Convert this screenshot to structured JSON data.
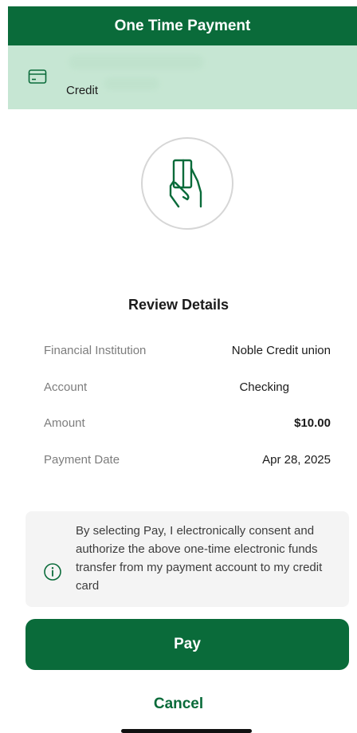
{
  "header": {
    "title": "One Time Payment"
  },
  "account_banner": {
    "icon": "credit-card-icon",
    "label": "Credit"
  },
  "illustration": {
    "icon": "hand-holding-card-icon"
  },
  "review": {
    "title": "Review Details",
    "rows": [
      {
        "label": "Financial Institution",
        "value": "Noble Credit union"
      },
      {
        "label": "Account",
        "value": "Checking"
      },
      {
        "label": "Amount",
        "value": "$10.00"
      },
      {
        "label": "Payment Date",
        "value": "Apr 28, 2025"
      }
    ]
  },
  "consent": {
    "icon": "info-icon",
    "text": "By selecting Pay, I electronically consent and authorize the above one-time electronic funds transfer from my payment account to my credit card"
  },
  "actions": {
    "pay_label": "Pay",
    "cancel_label": "Cancel"
  },
  "colors": {
    "brand": "#0a6b3a",
    "banner": "#c6e6d3"
  }
}
